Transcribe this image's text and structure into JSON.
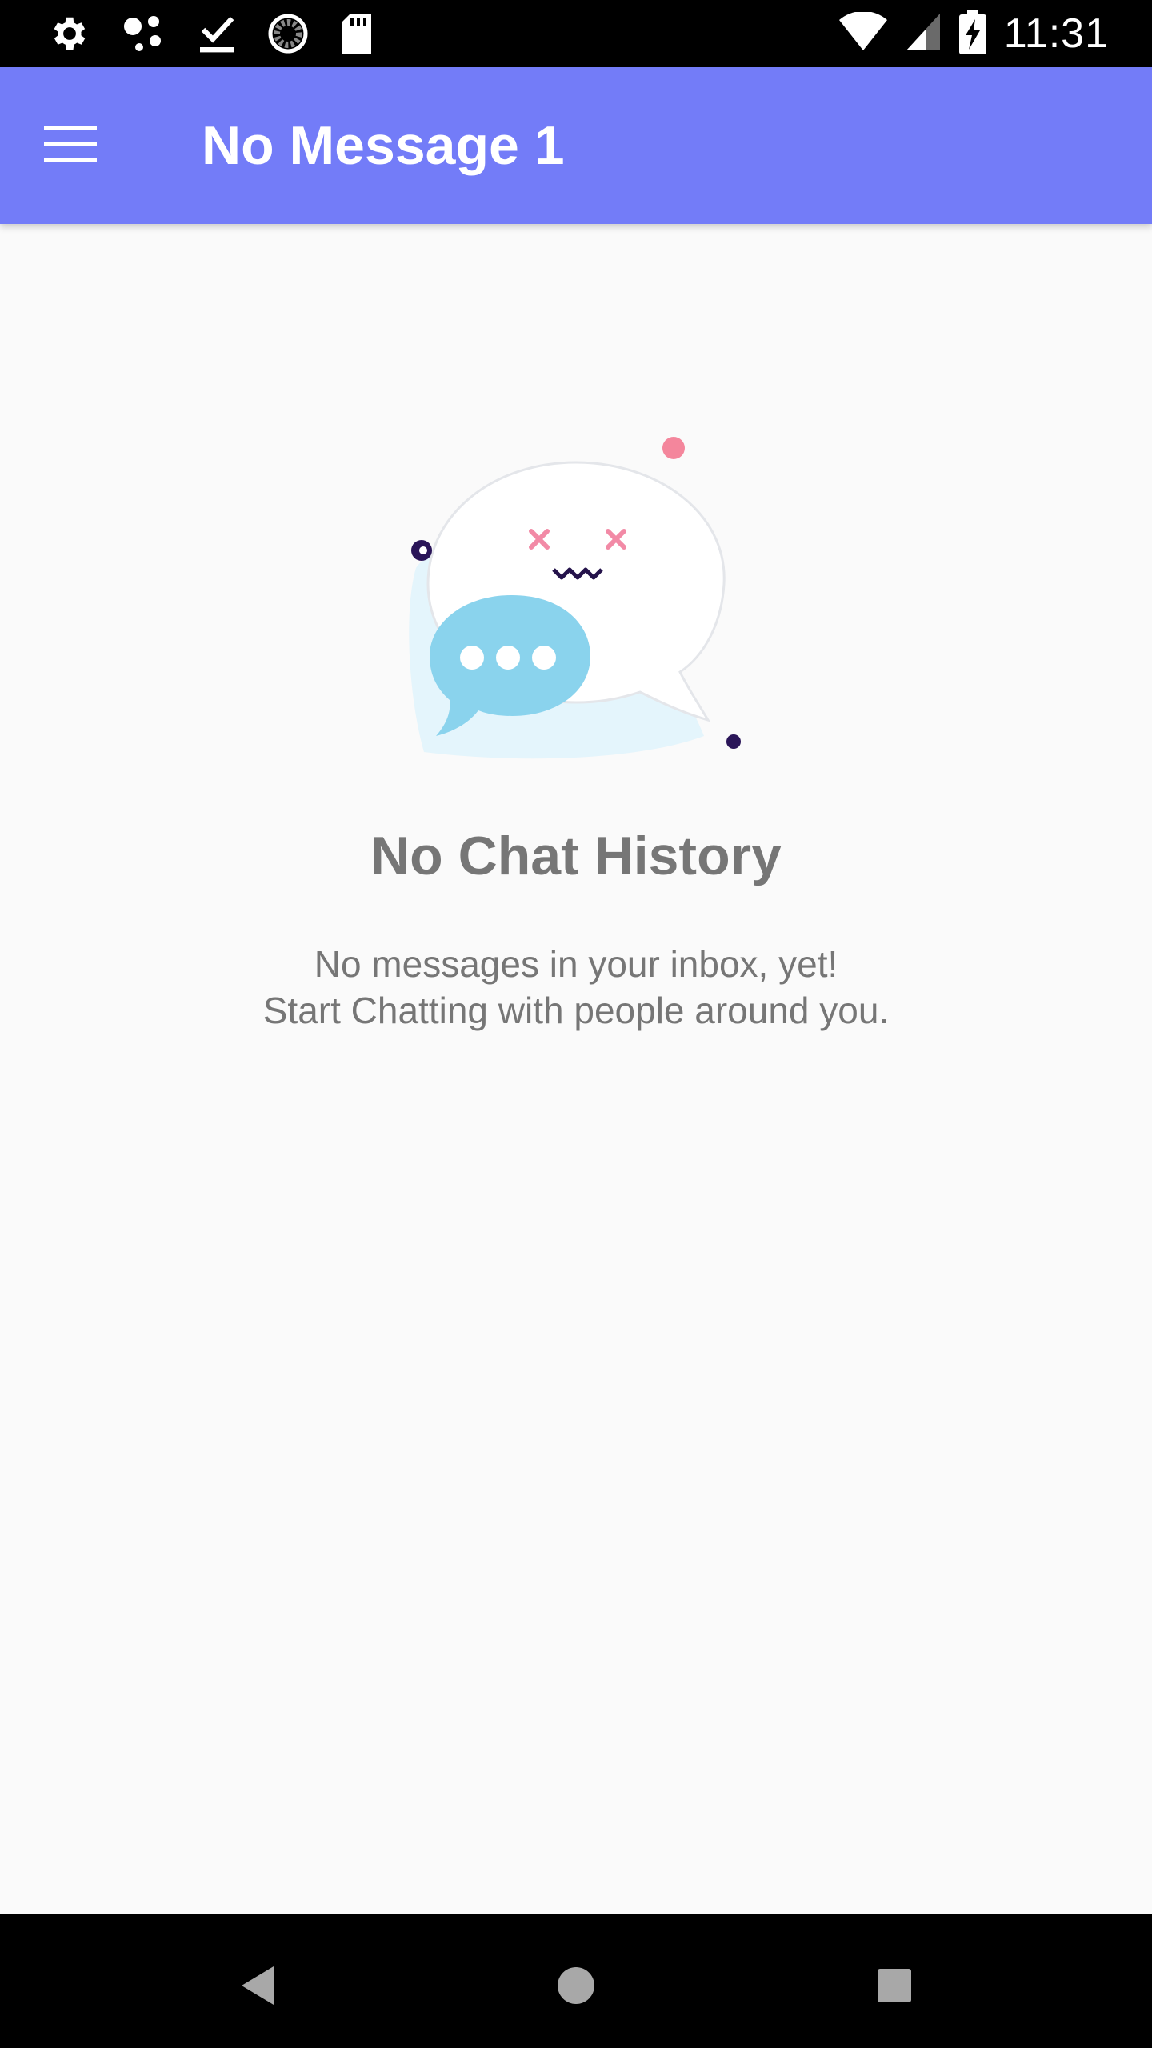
{
  "status_bar": {
    "time": "11:31",
    "left_icons": [
      "settings-icon",
      "dots-icon",
      "download-done-icon",
      "loading-icon",
      "sd-card-icon"
    ],
    "right_icons": [
      "wifi-icon",
      "cell-signal-icon",
      "battery-charging-icon"
    ]
  },
  "app_bar": {
    "title": "No Message 1",
    "menu_icon": "hamburger-menu-icon",
    "color": "#737cf8"
  },
  "empty_state": {
    "illustration": "chat-bubbles-illustration",
    "title": "No Chat History",
    "line1": "No messages in your inbox, yet!",
    "line2": "Start Chatting with people around you."
  },
  "nav_bar": {
    "icons": [
      "back-icon",
      "home-icon",
      "recents-icon"
    ]
  }
}
